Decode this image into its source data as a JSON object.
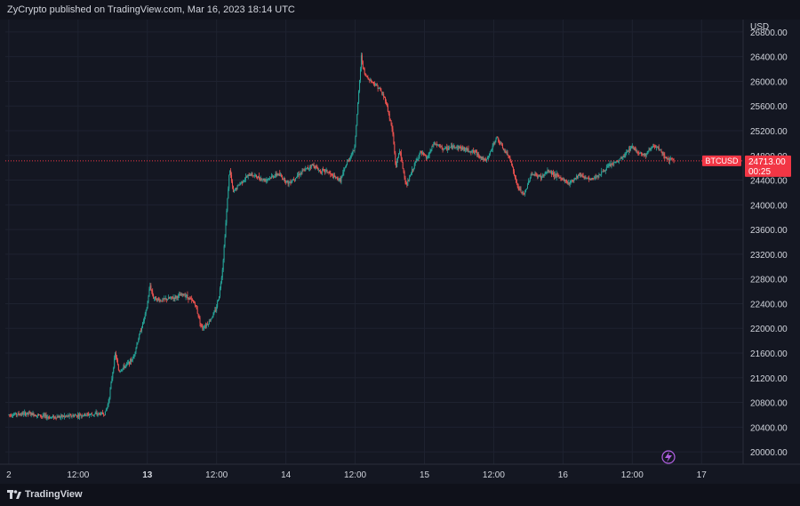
{
  "header": {
    "publisher_line": "ZyCrypto published on TradingView.com, Mar 16, 2023 18:14 UTC"
  },
  "footer": {
    "brand": "TradingView"
  },
  "price_tag": {
    "symbol": "BTCUSD",
    "price": "24713.00",
    "countdown": "00:25",
    "color": "#f23645"
  },
  "colors": {
    "up": "#26a69a",
    "down": "#ef5350",
    "grid": "#1e2230",
    "background": "#141722"
  },
  "chart_data": {
    "type": "candlestick",
    "symbol": "BTCUSD",
    "y_unit": "USD",
    "ylim": [
      19800,
      27000
    ],
    "y_ticks": [
      20000,
      20400,
      20800,
      21200,
      21600,
      22000,
      22400,
      22800,
      23200,
      23600,
      24000,
      24400,
      24800,
      25200,
      25600,
      26000,
      26400,
      26800
    ],
    "x_ticks": [
      {
        "label": "2",
        "t": 0,
        "bold": false
      },
      {
        "label": "12:00",
        "t": 1,
        "bold": false
      },
      {
        "label": "13",
        "t": 2,
        "bold": true
      },
      {
        "label": "12:00",
        "t": 3,
        "bold": false
      },
      {
        "label": "14",
        "t": 4,
        "bold": false
      },
      {
        "label": "12:00",
        "t": 5,
        "bold": false
      },
      {
        "label": "15",
        "t": 6,
        "bold": false
      },
      {
        "label": "12:00",
        "t": 7,
        "bold": false
      },
      {
        "label": "16",
        "t": 8,
        "bold": false
      },
      {
        "label": "12:00",
        "t": 9,
        "bold": false
      },
      {
        "label": "17",
        "t": 10,
        "bold": false
      }
    ],
    "xlim": [
      -0.05,
      10.6
    ],
    "last_price": 24713,
    "price_path": [
      [
        0,
        20600
      ],
      [
        0.3,
        20620
      ],
      [
        0.6,
        20560
      ],
      [
        0.9,
        20580
      ],
      [
        1.1,
        20600
      ],
      [
        1.4,
        20620
      ],
      [
        1.45,
        20800
      ],
      [
        1.5,
        21200
      ],
      [
        1.55,
        21600
      ],
      [
        1.6,
        21300
      ],
      [
        1.7,
        21400
      ],
      [
        1.8,
        21500
      ],
      [
        1.9,
        21900
      ],
      [
        2.0,
        22300
      ],
      [
        2.05,
        22700
      ],
      [
        2.1,
        22500
      ],
      [
        2.2,
        22450
      ],
      [
        2.4,
        22500
      ],
      [
        2.55,
        22550
      ],
      [
        2.7,
        22400
      ],
      [
        2.8,
        22000
      ],
      [
        2.9,
        22100
      ],
      [
        3.0,
        22300
      ],
      [
        3.05,
        22550
      ],
      [
        3.1,
        23000
      ],
      [
        3.15,
        23800
      ],
      [
        3.2,
        24600
      ],
      [
        3.25,
        24200
      ],
      [
        3.35,
        24350
      ],
      [
        3.5,
        24500
      ],
      [
        3.7,
        24400
      ],
      [
        3.9,
        24500
      ],
      [
        4.05,
        24350
      ],
      [
        4.2,
        24500
      ],
      [
        4.4,
        24650
      ],
      [
        4.5,
        24550
      ],
      [
        4.6,
        24550
      ],
      [
        4.7,
        24450
      ],
      [
        4.8,
        24400
      ],
      [
        4.9,
        24700
      ],
      [
        5.0,
        24900
      ],
      [
        5.05,
        25600
      ],
      [
        5.1,
        26400
      ],
      [
        5.15,
        26100
      ],
      [
        5.25,
        26000
      ],
      [
        5.35,
        25900
      ],
      [
        5.45,
        25700
      ],
      [
        5.55,
        25200
      ],
      [
        5.6,
        24600
      ],
      [
        5.65,
        24900
      ],
      [
        5.75,
        24300
      ],
      [
        5.85,
        24600
      ],
      [
        5.95,
        24850
      ],
      [
        6.05,
        24750
      ],
      [
        6.15,
        25000
      ],
      [
        6.3,
        24900
      ],
      [
        6.45,
        24950
      ],
      [
        6.6,
        24900
      ],
      [
        6.75,
        24850
      ],
      [
        6.9,
        24700
      ],
      [
        7.0,
        24950
      ],
      [
        7.05,
        25100
      ],
      [
        7.15,
        24900
      ],
      [
        7.25,
        24750
      ],
      [
        7.35,
        24300
      ],
      [
        7.45,
        24150
      ],
      [
        7.55,
        24500
      ],
      [
        7.7,
        24450
      ],
      [
        7.8,
        24550
      ],
      [
        7.95,
        24450
      ],
      [
        8.1,
        24350
      ],
      [
        8.25,
        24500
      ],
      [
        8.4,
        24400
      ],
      [
        8.55,
        24500
      ],
      [
        8.7,
        24650
      ],
      [
        8.8,
        24700
      ],
      [
        8.9,
        24800
      ],
      [
        9.0,
        24950
      ],
      [
        9.1,
        24850
      ],
      [
        9.2,
        24800
      ],
      [
        9.3,
        24950
      ],
      [
        9.4,
        24900
      ],
      [
        9.5,
        24750
      ],
      [
        9.6,
        24713
      ]
    ]
  }
}
